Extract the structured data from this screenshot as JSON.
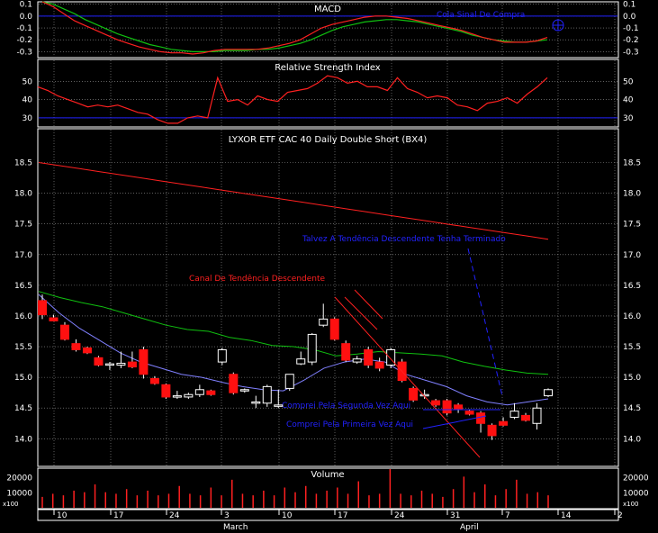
{
  "colors": {
    "background": "#000000",
    "panel_border": "#ffffff",
    "grid": "#9a9a9a",
    "axis_text": "#ffffff",
    "title_text": "#ffffff",
    "annotation": "#2222ff",
    "annotation_red": "#ff2020",
    "bear_candle": "#ff1010",
    "bull_candle": "#ffffff",
    "price_ma_red": "#ff2020",
    "price_ma_green": "#10c010",
    "price_ma_blue": "#8080ff",
    "macd_line": "#ff2020",
    "macd_signal": "#10c010",
    "rsi_line": "#ff2020",
    "volume_bar": "#ff2020"
  },
  "chart_data": [
    {
      "type": "line",
      "panel": "macd",
      "title": "MACD",
      "ylim": [
        -0.35,
        0.12
      ],
      "yticks": [
        "0.1",
        "0.0",
        "-0.1",
        "-0.2",
        "-0.3"
      ],
      "ytick_values": [
        0.1,
        0.0,
        -0.1,
        -0.2,
        -0.3
      ],
      "series": [
        {
          "role": "macd",
          "values": [
            0.12,
            0.08,
            0.02,
            -0.04,
            -0.08,
            -0.12,
            -0.16,
            -0.2,
            -0.23,
            -0.26,
            -0.28,
            -0.3,
            -0.31,
            -0.31,
            -0.32,
            -0.31,
            -0.29,
            -0.28,
            -0.28,
            -0.28,
            -0.28,
            -0.27,
            -0.25,
            -0.23,
            -0.2,
            -0.15,
            -0.1,
            -0.07,
            -0.05,
            -0.03,
            -0.01,
            0.0,
            0.0,
            -0.01,
            -0.02,
            -0.04,
            -0.06,
            -0.08,
            -0.1,
            -0.12,
            -0.15,
            -0.18,
            -0.2,
            -0.22,
            -0.22,
            -0.22,
            -0.21,
            -0.18
          ]
        },
        {
          "role": "signal",
          "values": [
            0.12,
            0.1,
            0.06,
            0.02,
            -0.03,
            -0.07,
            -0.11,
            -0.15,
            -0.18,
            -0.21,
            -0.24,
            -0.26,
            -0.28,
            -0.29,
            -0.3,
            -0.3,
            -0.3,
            -0.29,
            -0.29,
            -0.29,
            -0.28,
            -0.28,
            -0.27,
            -0.25,
            -0.23,
            -0.2,
            -0.16,
            -0.12,
            -0.09,
            -0.07,
            -0.05,
            -0.04,
            -0.03,
            -0.03,
            -0.04,
            -0.05,
            -0.07,
            -0.09,
            -0.11,
            -0.13,
            -0.16,
            -0.18,
            -0.2,
            -0.21,
            -0.22,
            -0.22,
            -0.21,
            -0.2
          ]
        }
      ],
      "annotations": [
        {
          "text": "Cola Sinal De Compra"
        }
      ]
    },
    {
      "type": "line",
      "panel": "rsi",
      "title": "Relative Strength Index",
      "ylim": [
        25,
        62
      ],
      "yticks": [
        "50",
        "40",
        "30"
      ],
      "ytick_values": [
        50,
        40,
        30
      ],
      "reference_line": 30,
      "values": [
        47,
        45,
        42,
        40,
        38,
        36,
        37,
        36,
        37,
        35,
        33,
        32,
        29,
        27,
        27,
        30,
        31,
        30,
        52,
        39,
        40,
        37,
        42,
        40,
        39,
        44,
        45,
        46,
        49,
        53,
        52,
        49,
        50,
        47,
        47,
        45,
        52,
        46,
        44,
        41,
        42,
        41,
        37,
        36,
        34,
        38,
        39,
        41,
        38,
        43,
        47,
        52
      ]
    },
    {
      "type": "candlestick",
      "panel": "price",
      "title": "LYXOR ETF CAC 40 Daily Double Short (BX4)",
      "ylim": [
        13.55,
        19.05
      ],
      "yticks": [
        "18.5",
        "18.0",
        "17.5",
        "17.0",
        "16.5",
        "16.0",
        "15.5",
        "15.0",
        "14.5",
        "14.0"
      ],
      "ytick_values": [
        18.5,
        18.0,
        17.5,
        17.0,
        16.5,
        16.0,
        15.5,
        15.0,
        14.5,
        14.0
      ],
      "candles": [
        {
          "o": 16.25,
          "h": 16.35,
          "l": 15.95,
          "c": 16.02
        },
        {
          "o": 15.97,
          "h": 16.02,
          "l": 15.92,
          "c": 15.92
        },
        {
          "o": 15.85,
          "h": 15.9,
          "l": 15.6,
          "c": 15.62
        },
        {
          "o": 15.55,
          "h": 15.62,
          "l": 15.42,
          "c": 15.45
        },
        {
          "o": 15.48,
          "h": 15.5,
          "l": 15.38,
          "c": 15.4
        },
        {
          "o": 15.32,
          "h": 15.35,
          "l": 15.18,
          "c": 15.2
        },
        {
          "o": 15.2,
          "h": 15.25,
          "l": 15.12,
          "c": 15.22
        },
        {
          "o": 15.2,
          "h": 15.42,
          "l": 15.15,
          "c": 15.23
        },
        {
          "o": 15.25,
          "h": 15.42,
          "l": 15.15,
          "c": 15.17
        },
        {
          "o": 15.45,
          "h": 15.5,
          "l": 14.98,
          "c": 15.05
        },
        {
          "o": 14.98,
          "h": 15.02,
          "l": 14.88,
          "c": 14.9
        },
        {
          "o": 14.88,
          "h": 14.9,
          "l": 14.65,
          "c": 14.68
        },
        {
          "o": 14.7,
          "h": 14.78,
          "l": 14.65,
          "c": 14.7
        },
        {
          "o": 14.68,
          "h": 14.75,
          "l": 14.65,
          "c": 14.72
        },
        {
          "o": 14.72,
          "h": 14.88,
          "l": 14.68,
          "c": 14.8
        },
        {
          "o": 14.78,
          "h": 14.8,
          "l": 14.7,
          "c": 14.72
        },
        {
          "o": 15.25,
          "h": 15.48,
          "l": 15.2,
          "c": 15.45
        },
        {
          "o": 15.05,
          "h": 15.08,
          "l": 14.72,
          "c": 14.75
        },
        {
          "o": 14.78,
          "h": 14.82,
          "l": 14.75,
          "c": 14.8
        },
        {
          "o": 14.58,
          "h": 14.7,
          "l": 14.5,
          "c": 14.6
        },
        {
          "o": 14.58,
          "h": 14.88,
          "l": 14.52,
          "c": 14.85
        },
        {
          "o": 14.55,
          "h": 14.8,
          "l": 14.5,
          "c": 14.55
        },
        {
          "o": 14.82,
          "h": 15.05,
          "l": 14.78,
          "c": 15.05
        },
        {
          "o": 15.22,
          "h": 15.42,
          "l": 15.2,
          "c": 15.3
        },
        {
          "o": 15.25,
          "h": 15.72,
          "l": 15.2,
          "c": 15.7
        },
        {
          "o": 15.85,
          "h": 16.2,
          "l": 15.82,
          "c": 15.95
        },
        {
          "o": 15.95,
          "h": 15.98,
          "l": 15.6,
          "c": 15.62
        },
        {
          "o": 15.55,
          "h": 15.6,
          "l": 15.25,
          "c": 15.28
        },
        {
          "o": 15.25,
          "h": 15.35,
          "l": 15.22,
          "c": 15.3
        },
        {
          "o": 15.45,
          "h": 15.5,
          "l": 15.15,
          "c": 15.2
        },
        {
          "o": 15.25,
          "h": 15.32,
          "l": 15.1,
          "c": 15.15
        },
        {
          "o": 15.2,
          "h": 15.48,
          "l": 15.15,
          "c": 15.45
        },
        {
          "o": 15.25,
          "h": 15.3,
          "l": 14.92,
          "c": 14.95
        },
        {
          "o": 14.82,
          "h": 14.85,
          "l": 14.6,
          "c": 14.63
        },
        {
          "o": 14.7,
          "h": 14.8,
          "l": 14.65,
          "c": 14.72
        },
        {
          "o": 14.62,
          "h": 14.65,
          "l": 14.52,
          "c": 14.55
        },
        {
          "o": 14.62,
          "h": 14.65,
          "l": 14.38,
          "c": 14.42
        },
        {
          "o": 14.55,
          "h": 14.58,
          "l": 14.42,
          "c": 14.48
        },
        {
          "o": 14.45,
          "h": 14.48,
          "l": 14.38,
          "c": 14.4
        },
        {
          "o": 14.42,
          "h": 14.45,
          "l": 14.1,
          "c": 14.25
        },
        {
          "o": 14.22,
          "h": 14.25,
          "l": 13.98,
          "c": 14.05
        },
        {
          "o": 14.28,
          "h": 14.35,
          "l": 14.2,
          "c": 14.22
        },
        {
          "o": 14.35,
          "h": 14.58,
          "l": 14.32,
          "c": 14.45
        },
        {
          "o": 14.38,
          "h": 14.42,
          "l": 14.28,
          "c": 14.3
        },
        {
          "o": 14.25,
          "h": 14.58,
          "l": 14.15,
          "c": 14.5
        },
        {
          "o": 14.7,
          "h": 14.82,
          "l": 14.68,
          "c": 14.8
        }
      ],
      "moving_averages": [
        {
          "color_key": "price_ma_red",
          "values": [
            18.5,
            18.45,
            18.4,
            18.35,
            18.3,
            18.25,
            18.2,
            18.15,
            18.1,
            18.05,
            18.0,
            17.95,
            17.9,
            17.85,
            17.8,
            17.75,
            17.7,
            17.65,
            17.6,
            17.55,
            17.5,
            17.45,
            17.4,
            17.35,
            17.3,
            17.25
          ]
        },
        {
          "color_key": "price_ma_green",
          "values": [
            16.4,
            16.3,
            16.22,
            16.15,
            16.05,
            15.95,
            15.85,
            15.78,
            15.75,
            15.65,
            15.6,
            15.52,
            15.5,
            15.45,
            15.35,
            15.38,
            15.42,
            15.4,
            15.38,
            15.35,
            15.25,
            15.18,
            15.12,
            15.07,
            15.05
          ]
        },
        {
          "color_key": "price_ma_blue",
          "values": [
            16.35,
            16.05,
            15.8,
            15.6,
            15.4,
            15.25,
            15.15,
            15.05,
            15.0,
            14.92,
            14.85,
            14.8,
            14.78,
            14.95,
            15.15,
            15.25,
            15.3,
            15.25,
            15.05,
            14.95,
            14.85,
            14.7,
            14.6,
            14.55,
            14.6,
            14.65
          ]
        }
      ],
      "annotations": [
        {
          "text": "Canal De Tendência Descendente"
        },
        {
          "text": "Talvez A Tendência Descendente Tenha Terminado"
        },
        {
          "text": "Comprei Pela Segunda Vez Aqui"
        },
        {
          "text": "Comprei Pela Primeira Vez Aqui"
        }
      ]
    },
    {
      "type": "bar",
      "panel": "volume",
      "title": "Volume",
      "yticks": [
        "20000",
        "10000"
      ],
      "ytick_values": [
        20000,
        10000
      ],
      "scale_label": "x100",
      "values": [
        7000,
        9000,
        8000,
        11000,
        10000,
        15000,
        10000,
        9000,
        12000,
        8000,
        11000,
        8000,
        9000,
        14000,
        9000,
        8000,
        13000,
        8000,
        18000,
        9000,
        8000,
        11000,
        8000,
        13000,
        10000,
        14000,
        9000,
        11000,
        13000,
        9000,
        17000,
        8000,
        9000,
        27000,
        9000,
        8000,
        11000,
        9000,
        7000,
        12000,
        20000,
        10000,
        15000,
        8000,
        12000,
        18000,
        9000,
        10000,
        8000
      ]
    }
  ],
  "x_axis": {
    "tick_labels": [
      "10",
      "17",
      "24",
      "3",
      "10",
      "17",
      "24",
      "31",
      "7",
      "14",
      "2"
    ],
    "month_labels": [
      "March",
      "April"
    ]
  }
}
